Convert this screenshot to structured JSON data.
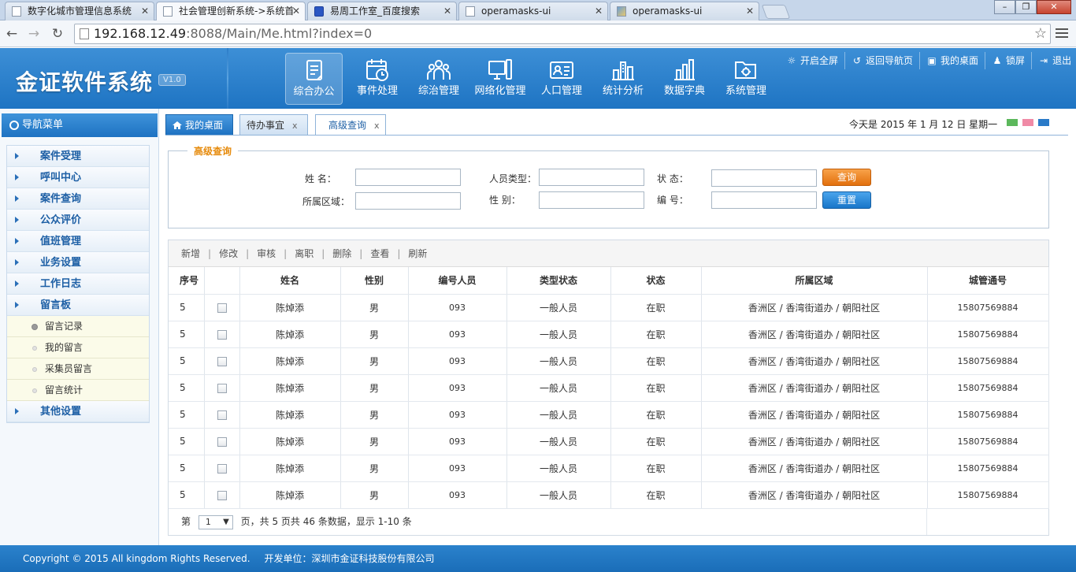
{
  "browser": {
    "tabs": [
      {
        "title": "数字化城市管理信息系统",
        "icon": "page"
      },
      {
        "title": "社会管理创新系统->系统首",
        "icon": "page"
      },
      {
        "title": "易周工作室_百度搜索",
        "icon": "paw"
      },
      {
        "title": "operamasks-ui",
        "icon": "page"
      },
      {
        "title": "operamasks-ui",
        "icon": "image"
      }
    ],
    "active_tab": 1,
    "url_host": "192.168.12.49",
    "url_rest": ":8088/Main/Me.html?index=0"
  },
  "header": {
    "brand": "金证软件系统",
    "version": "V1.0",
    "modules": [
      {
        "label": "综合办公",
        "icon": "document-icon"
      },
      {
        "label": "事件处理",
        "icon": "calendar-clock-icon"
      },
      {
        "label": "综治管理",
        "icon": "people-group-icon"
      },
      {
        "label": "网络化管理",
        "icon": "monitor-icon"
      },
      {
        "label": "人口管理",
        "icon": "id-card-icon"
      },
      {
        "label": "统计分析",
        "icon": "building-chart-icon"
      },
      {
        "label": "数据字典",
        "icon": "bar-chart-icon"
      },
      {
        "label": "系统管理",
        "icon": "folder-gear-icon"
      }
    ],
    "top_links": [
      {
        "label": "开启全屏",
        "icon": "☼"
      },
      {
        "label": "返回导航页",
        "icon": "↺"
      },
      {
        "label": "我的桌面",
        "icon": "▣"
      },
      {
        "label": "锁屏",
        "icon": "♟"
      },
      {
        "label": "退出",
        "icon": "⇥"
      }
    ]
  },
  "sidebar": {
    "title": "导航菜单",
    "items": [
      {
        "label": "案件受理"
      },
      {
        "label": "呼叫中心"
      },
      {
        "label": "案件查询"
      },
      {
        "label": "公众评价"
      },
      {
        "label": "值班管理"
      },
      {
        "label": "业务设置"
      },
      {
        "label": "工作日志"
      },
      {
        "label": "留言板",
        "children": [
          "留言记录",
          "我的留言",
          "采集员留言",
          "留言统计"
        ]
      },
      {
        "label": "其他设置"
      }
    ]
  },
  "content_tabs": {
    "home": "我的桌面",
    "todo": "待办事宜",
    "search": "高级查询",
    "close": "x"
  },
  "date_info": "今天是 2015 年 1 月 12 日 星期一",
  "skin_colors": [
    "#5cb85c",
    "#f08aa6",
    "#2a7ac8"
  ],
  "search": {
    "legend": "高级查询",
    "labels": {
      "name": "姓    名：",
      "person_type": "人员类型：",
      "status": "状    态：",
      "area": "所属区域：",
      "gender": "性    别：",
      "number": "编    号："
    },
    "query_button": "查询",
    "reset_button": "重置"
  },
  "toolbar": [
    "新增",
    "修改",
    "审核",
    "离职",
    "删除",
    "查看",
    "刷新"
  ],
  "table": {
    "headers": [
      "序号",
      "",
      "姓名",
      "性别",
      "编号人员",
      "类型状态",
      "状态",
      "所属区域",
      "城管通号"
    ],
    "rows": [
      [
        "5",
        "",
        "陈焯添",
        "男",
        "093",
        "一般人员",
        "在职",
        "香洲区 / 香湾街道办 / 朝阳社区",
        "15807569884"
      ],
      [
        "5",
        "",
        "陈焯添",
        "男",
        "093",
        "一般人员",
        "在职",
        "香洲区 / 香湾街道办 / 朝阳社区",
        "15807569884"
      ],
      [
        "5",
        "",
        "陈焯添",
        "男",
        "093",
        "一般人员",
        "在职",
        "香洲区 / 香湾街道办 / 朝阳社区",
        "15807569884"
      ],
      [
        "5",
        "",
        "陈焯添",
        "男",
        "093",
        "一般人员",
        "在职",
        "香洲区 / 香湾街道办 / 朝阳社区",
        "15807569884"
      ],
      [
        "5",
        "",
        "陈焯添",
        "男",
        "093",
        "一般人员",
        "在职",
        "香洲区 / 香湾街道办 / 朝阳社区",
        "15807569884"
      ],
      [
        "5",
        "",
        "陈焯添",
        "男",
        "093",
        "一般人员",
        "在职",
        "香洲区 / 香湾街道办 / 朝阳社区",
        "15807569884"
      ],
      [
        "5",
        "",
        "陈焯添",
        "男",
        "093",
        "一般人员",
        "在职",
        "香洲区 / 香湾街道办 / 朝阳社区",
        "15807569884"
      ],
      [
        "5",
        "",
        "陈焯添",
        "男",
        "093",
        "一般人员",
        "在职",
        "香洲区 / 香湾街道办 / 朝阳社区",
        "15807569884"
      ]
    ]
  },
  "pager": {
    "prefix": "第",
    "page": "1",
    "suffix": "页，共 5 页共 46 条数据，显示 1-10 条"
  },
  "footer": {
    "copyright": "Copyright © 2015 All kingdom Rights Reserved.",
    "developer": "开发单位：深圳市金证科技股份有限公司"
  }
}
